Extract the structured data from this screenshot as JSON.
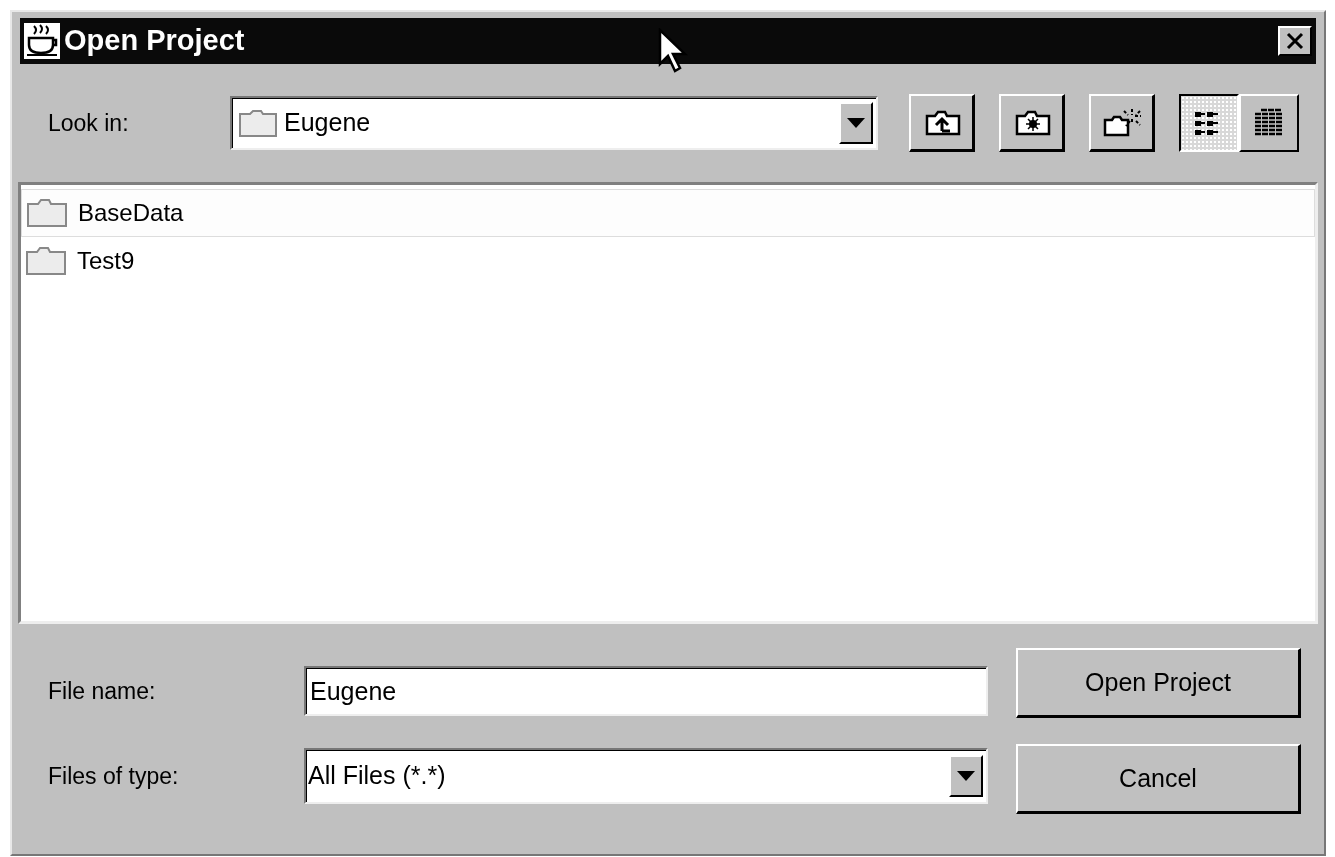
{
  "window": {
    "title": "Open Project"
  },
  "look_in": {
    "label": "Look in:",
    "value": "Eugene"
  },
  "toolbar": [
    {
      "kind": "up"
    },
    {
      "kind": "home"
    },
    {
      "kind": "new-folder"
    }
  ],
  "view_toggles": [
    {
      "kind": "list",
      "selected": true
    },
    {
      "kind": "details",
      "selected": false
    }
  ],
  "files": [
    {
      "name": "BaseData",
      "selected": true
    },
    {
      "name": "Test9",
      "selected": false
    }
  ],
  "file_name": {
    "label": "File name:",
    "value": "Eugene"
  },
  "file_type": {
    "label": "Files of type:",
    "value": "All Files (*.*)"
  },
  "buttons": [
    "Open Project",
    "Cancel"
  ]
}
